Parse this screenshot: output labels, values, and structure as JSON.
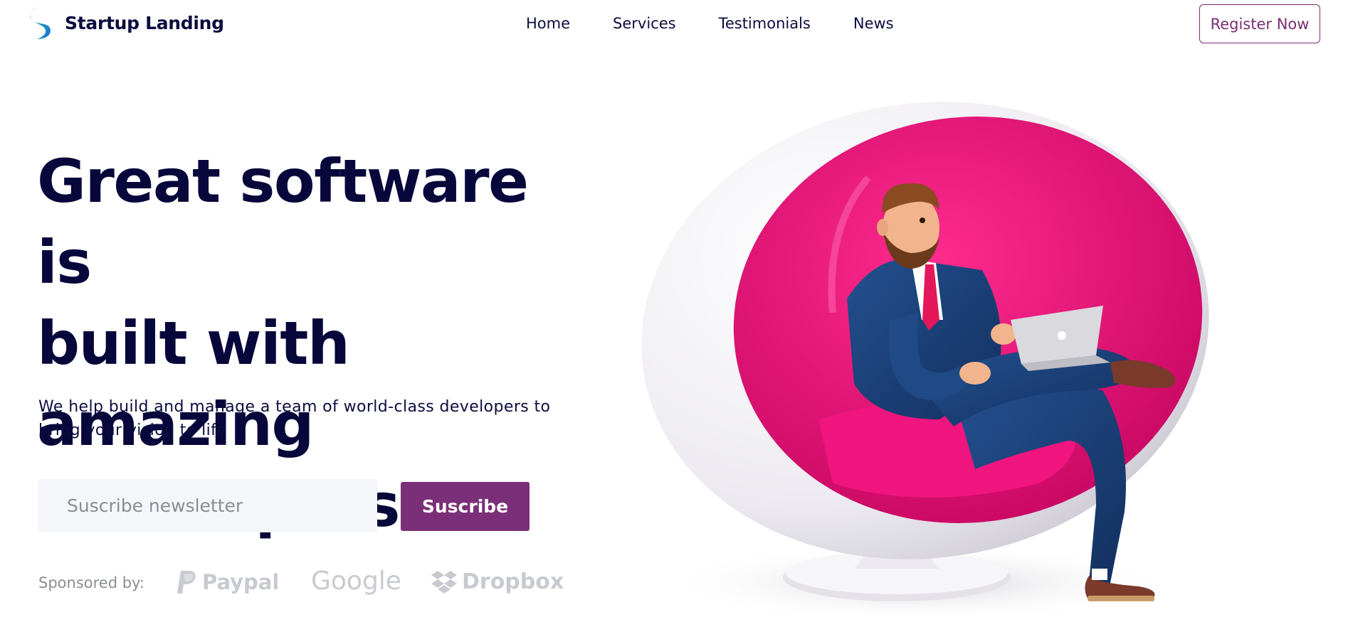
{
  "header": {
    "brand_name": "Startup Landing",
    "logo_icon": "s-swirl-logo-icon",
    "nav": [
      {
        "label": "Home"
      },
      {
        "label": "Services"
      },
      {
        "label": "Testimonials"
      },
      {
        "label": "News"
      }
    ],
    "register_label": "Register Now"
  },
  "hero": {
    "title_lines": [
      "Great software is",
      "built with amazing",
      "developers"
    ],
    "subtitle": "We help build and manage a team of world-class developers to bring your vision to life",
    "newsletter_placeholder": "Suscribe newsletter",
    "subscribe_label": "Suscribe",
    "sponsored_label": "Sponsored by:",
    "sponsors": [
      {
        "name": "Paypal",
        "icon": "paypal-icon"
      },
      {
        "name": "Google",
        "icon": ""
      },
      {
        "name": "Dropbox",
        "icon": "dropbox-icon"
      }
    ],
    "illustration": "man-with-laptop-in-egg-chair"
  },
  "colors": {
    "brand_dark": "#0b0d3f",
    "accent_purple": "#7b2f78",
    "input_bg": "#f4f6fa",
    "chair_pink": "#e0066f",
    "logo_teal": "#1ab8a0",
    "logo_blue": "#1a73d9"
  }
}
